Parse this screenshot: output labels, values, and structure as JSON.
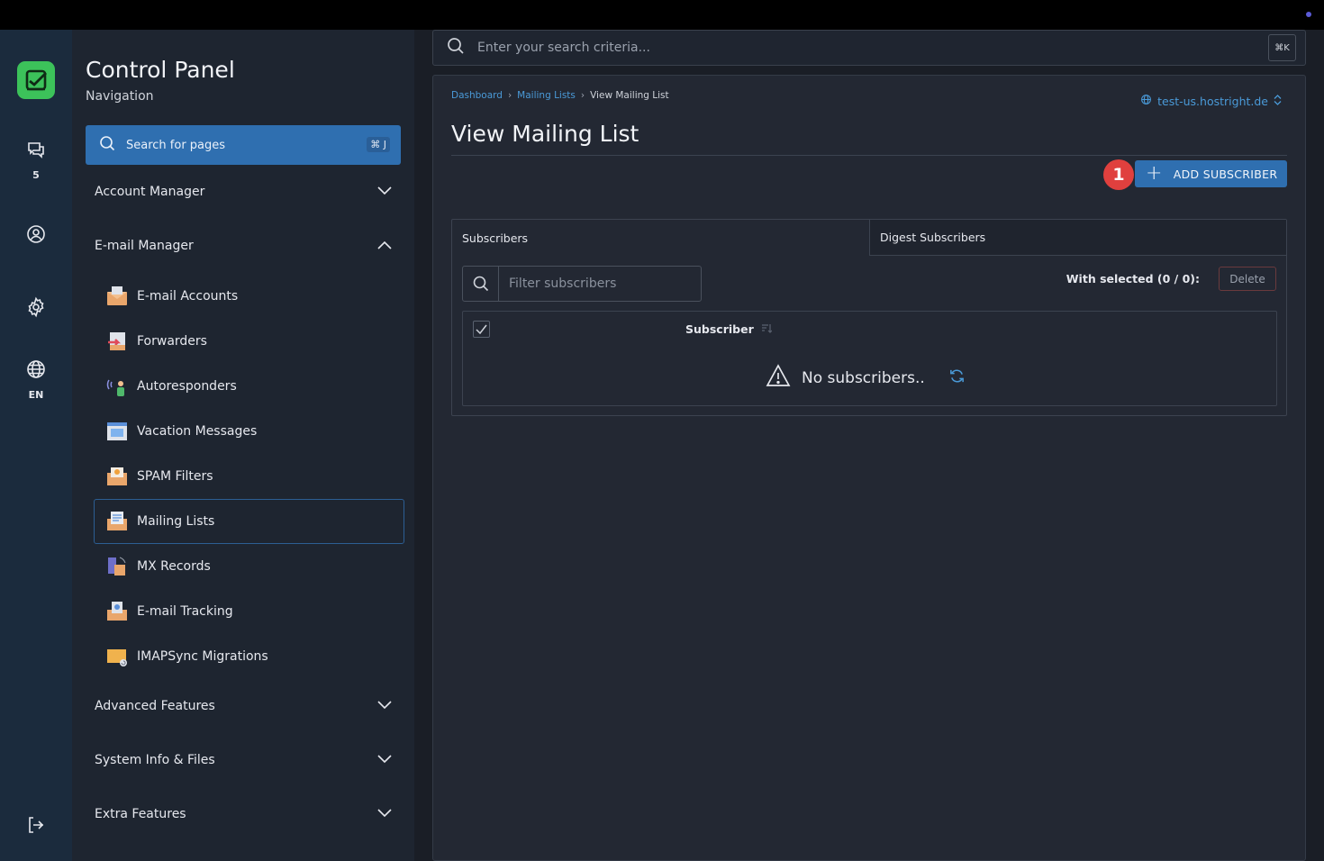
{
  "rail": {
    "chat_count": "5",
    "language": "EN"
  },
  "sidebar": {
    "title": "Control Panel",
    "subtitle": "Navigation",
    "search_placeholder": "Search for pages",
    "search_shortcut": "⌘ J",
    "sections": {
      "account_manager": "Account Manager",
      "email_manager": "E-mail Manager",
      "advanced_features": "Advanced Features",
      "system_info": "System Info & Files",
      "extra_features": "Extra Features"
    },
    "email_items": [
      {
        "label": "E-mail Accounts"
      },
      {
        "label": "Forwarders"
      },
      {
        "label": "Autoresponders"
      },
      {
        "label": "Vacation Messages"
      },
      {
        "label": "SPAM Filters"
      },
      {
        "label": "Mailing Lists"
      },
      {
        "label": "MX Records"
      },
      {
        "label": "E-mail Tracking"
      },
      {
        "label": "IMAPSync Migrations"
      }
    ],
    "active_item": "Mailing Lists"
  },
  "header": {
    "search_placeholder": "Enter your search criteria...",
    "search_shortcut": "⌘K"
  },
  "breadcrumb": {
    "items": [
      "Dashboard",
      "Mailing Lists",
      "View Mailing List"
    ]
  },
  "host": "test-us.hostright.de",
  "page": {
    "title": "View Mailing List",
    "step_badge": "1",
    "add_button": "ADD SUBSCRIBER"
  },
  "tabs": {
    "subscribers": "Subscribers",
    "digest": "Digest Subscribers"
  },
  "table": {
    "filter_placeholder": "Filter subscribers",
    "with_selected": "With selected (0 / 0):",
    "delete_label": "Delete",
    "column_subscriber": "Subscriber",
    "empty_text": "No subscribers.."
  },
  "colors": {
    "accent": "#2f6fb0",
    "link": "#4a9ad8",
    "badge": "#e0403e",
    "logo": "#3cc25a"
  }
}
